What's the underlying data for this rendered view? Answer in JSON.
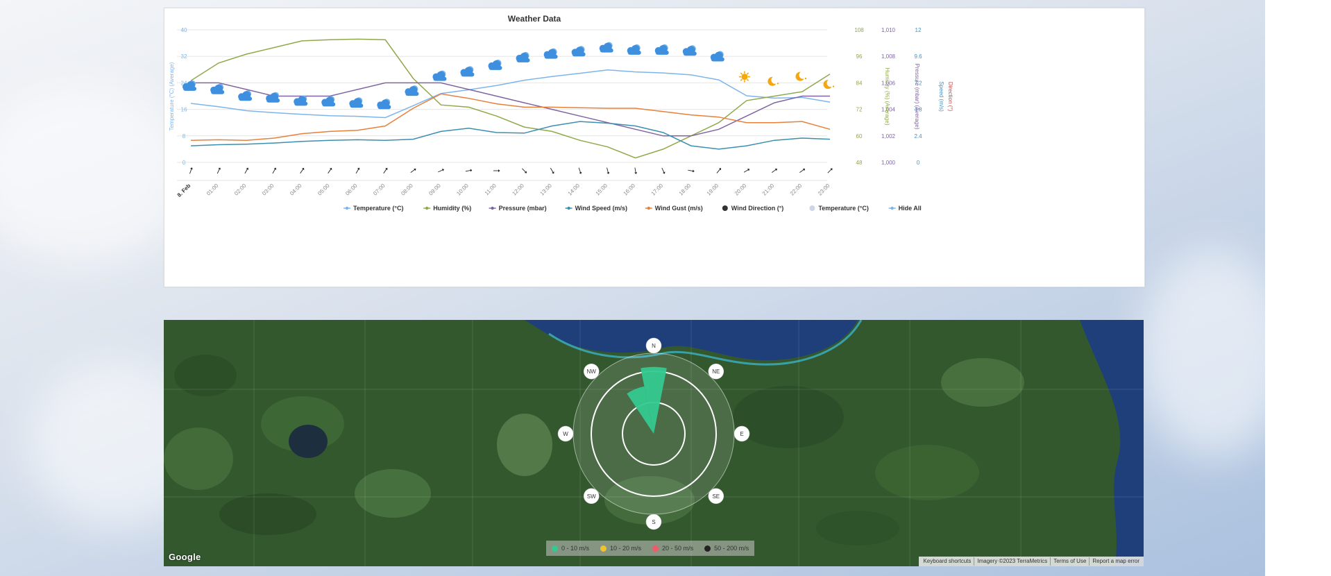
{
  "chart_data": {
    "type": "line",
    "title": "Weather Data",
    "x": [
      "8. Feb",
      "01:00",
      "02:00",
      "03:00",
      "04:00",
      "05:00",
      "06:00",
      "07:00",
      "08:00",
      "09:00",
      "10:00",
      "11:00",
      "12:00",
      "13:00",
      "14:00",
      "15:00",
      "16:00",
      "17:00",
      "18:00",
      "19:00",
      "20:00",
      "21:00",
      "22:00",
      "23:00"
    ],
    "axes": [
      {
        "id": "temp",
        "label": "Temperature (°C) (Average)",
        "range": [
          0,
          40
        ],
        "ticks": [
          "0",
          "8",
          "16",
          "24",
          "32",
          "40"
        ],
        "color": "#7cb5ec",
        "side": "left"
      },
      {
        "id": "hum",
        "label": "Humidity (%) (Average)",
        "range": [
          48,
          108
        ],
        "ticks": [
          "48",
          "60",
          "72",
          "84",
          "96",
          "108"
        ],
        "color": "#90a84a",
        "side": "right"
      },
      {
        "id": "pres",
        "label": "Pressure (mbar) (Average)",
        "range": [
          1000,
          1010
        ],
        "ticks": [
          "1,000",
          "1,002",
          "1,004",
          "1,006",
          "1,008",
          "1,010"
        ],
        "color": "#8064a2",
        "side": "right"
      },
      {
        "id": "speed",
        "label": "Speed (m/s)",
        "range": [
          0,
          12
        ],
        "ticks": [
          "0",
          "2.4",
          "4.8",
          "7.2",
          "9.6",
          "12"
        ],
        "color": "#4a90c0",
        "side": "right"
      },
      {
        "id": "dir",
        "label": "Direction (°)",
        "color": "#c0504d",
        "side": "right"
      }
    ],
    "series": [
      {
        "name": "Temperature (°C)",
        "axis": "temp",
        "color": "#7cb5ec",
        "values": [
          17.8,
          16.8,
          15.6,
          15.0,
          14.5,
          14.1,
          13.9,
          13.5,
          17.1,
          20.8,
          21.9,
          23.2,
          24.8,
          25.9,
          26.9,
          27.9,
          27.3,
          27.0,
          26.4,
          24.9,
          20.1,
          19.4,
          19.6,
          18.2
        ]
      },
      {
        "name": "Humidity (%)",
        "axis": "hum",
        "color": "#90a84a",
        "values": [
          85,
          93,
          97,
          100,
          103,
          103.5,
          103.8,
          103.5,
          86,
          74,
          73,
          69,
          64,
          62,
          58,
          55,
          50,
          54,
          60,
          66,
          76,
          78,
          80,
          88
        ]
      },
      {
        "name": "Pressure (mbar)",
        "axis": "pres",
        "color": "#8064a2",
        "values": [
          1006.0,
          1006.0,
          1005.5,
          1005.0,
          1005.0,
          1005.0,
          1005.5,
          1006.0,
          1006.0,
          1006.0,
          1005.5,
          1005.0,
          1004.5,
          1004.0,
          1003.5,
          1003.0,
          1002.5,
          1002.0,
          1002.0,
          1002.5,
          1003.5,
          1004.5,
          1005.0,
          1005.0
        ]
      },
      {
        "name": "Wind Speed (m/s)",
        "axis": "speed",
        "color": "#3a8fb0",
        "values": [
          1.5,
          1.6,
          1.65,
          1.75,
          1.9,
          2.0,
          2.05,
          2.0,
          2.1,
          2.8,
          3.1,
          2.7,
          2.65,
          3.3,
          3.7,
          3.55,
          3.3,
          2.7,
          1.5,
          1.2,
          1.5,
          2.0,
          2.2,
          2.1
        ]
      },
      {
        "name": "Wind Gust (m/s)",
        "axis": "speed",
        "color": "#e8803a",
        "values": [
          2.0,
          2.05,
          2.0,
          2.2,
          2.6,
          2.8,
          2.9,
          3.3,
          4.9,
          6.2,
          5.8,
          5.3,
          5.0,
          5.0,
          4.95,
          4.9,
          4.9,
          4.6,
          4.3,
          4.1,
          3.6,
          3.6,
          3.7,
          3.0
        ]
      }
    ],
    "wind_direction_deg": [
      200,
      205,
      210,
      210,
      215,
      215,
      210,
      215,
      235,
      245,
      260,
      270,
      315,
      330,
      340,
      345,
      350,
      335,
      280,
      220,
      240,
      235,
      235,
      225
    ],
    "weather_icons": [
      {
        "type": "cloud",
        "temp": 22
      },
      {
        "type": "cloud",
        "temp": 21
      },
      {
        "type": "cloud",
        "temp": 19
      },
      {
        "type": "cloud",
        "temp": 18.5
      },
      {
        "type": "cloud",
        "temp": 17.5
      },
      {
        "type": "cloud",
        "temp": 17.3
      },
      {
        "type": "cloud",
        "temp": 16.9
      },
      {
        "type": "cloud",
        "temp": 16.5
      },
      {
        "type": "cloud",
        "temp": 20.5
      },
      {
        "type": "cloud",
        "temp": 25
      },
      {
        "type": "cloud",
        "temp": 26.3
      },
      {
        "type": "cloud",
        "temp": 28.3
      },
      {
        "type": "cloud",
        "temp": 30.6
      },
      {
        "type": "cloud",
        "temp": 31.7
      },
      {
        "type": "cloud",
        "temp": 32.4
      },
      {
        "type": "cloud",
        "temp": 33.6
      },
      {
        "type": "cloud",
        "temp": 32.9
      },
      {
        "type": "cloud",
        "temp": 32.9
      },
      {
        "type": "cloud",
        "temp": 32.6
      },
      {
        "type": "cloud",
        "temp": 30.9
      },
      {
        "type": "sun",
        "temp": 25
      },
      {
        "type": "moon",
        "temp": 23.6
      },
      {
        "type": "moon",
        "temp": 25.1
      },
      {
        "type": "moon",
        "temp": 22.7
      }
    ],
    "legend": [
      {
        "label": "Temperature (°C)",
        "color": "#7cb5ec",
        "marker": "line"
      },
      {
        "label": "Humidity (%)",
        "color": "#90a84a",
        "marker": "line"
      },
      {
        "label": "Pressure (mbar)",
        "color": "#8064a2",
        "marker": "line"
      },
      {
        "label": "Wind Speed (m/s)",
        "color": "#3a8fb0",
        "marker": "line"
      },
      {
        "label": "Wind Gust (m/s)",
        "color": "#e8803a",
        "marker": "line"
      },
      {
        "label": "Wind Direction (°)",
        "color": "#333333",
        "marker": "dot"
      },
      {
        "label": "Temperature (°C)",
        "color": "#cfd5e6",
        "marker": "dot"
      },
      {
        "label": "Hide All",
        "color": "#7cb5ec",
        "marker": "line"
      }
    ],
    "grid": true,
    "legend_position": "bottom"
  },
  "wind_rose": {
    "directions": [
      "N",
      "NE",
      "E",
      "SE",
      "S",
      "SW",
      "W",
      "NW"
    ],
    "petals": [
      {
        "direction": "N",
        "bin": "0 - 10 m/s",
        "extent": 0.83
      },
      {
        "direction": "NNW",
        "bin": "0 - 10 m/s",
        "extent": 0.6
      }
    ],
    "legend": [
      {
        "label": "0 - 10 m/s",
        "color": "#34c990"
      },
      {
        "label": "10 - 20 m/s",
        "color": "#f2c12e"
      },
      {
        "label": "20 - 50 m/s",
        "color": "#f05a6a"
      },
      {
        "label": "50 - 200 m/s",
        "color": "#222222"
      }
    ]
  },
  "map": {
    "provider": "Google",
    "attribution": [
      "Keyboard shortcuts",
      "Imagery ©2023 TerraMetrics",
      "Terms of Use",
      "Report a map error"
    ]
  }
}
